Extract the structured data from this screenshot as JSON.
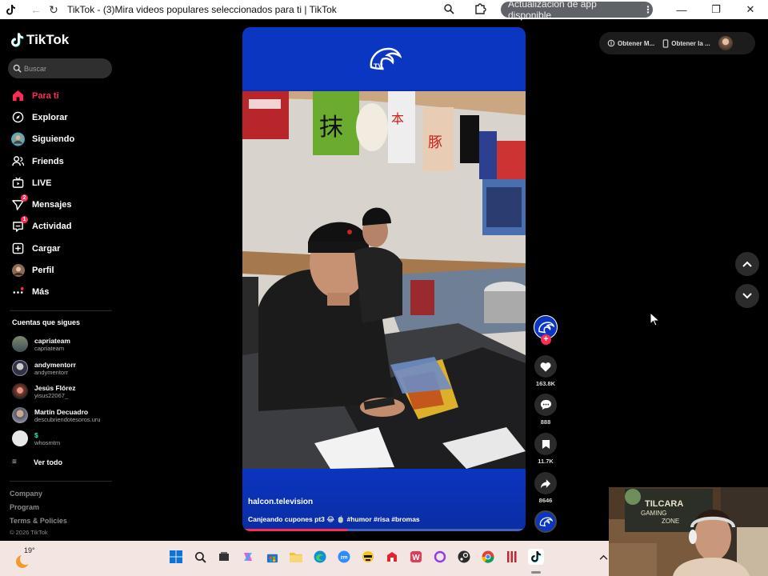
{
  "browser": {
    "tab_title": "TikTok - (3)Mira videos populares seleccionados para ti | TikTok",
    "update_pill": "Actualización de app disponible"
  },
  "sidebar": {
    "logo_text": "TikTok",
    "search_placeholder": "Buscar",
    "menu": [
      {
        "label": "Para ti",
        "icon": "home-icon",
        "active": true
      },
      {
        "label": "Explorar",
        "icon": "compass-icon"
      },
      {
        "label": "Siguiendo",
        "icon": "following-avatar-icon"
      },
      {
        "label": "Friends",
        "icon": "friends-icon"
      },
      {
        "label": "LIVE",
        "icon": "live-tv-icon"
      },
      {
        "label": "Mensajes",
        "icon": "send-icon",
        "badge": "2"
      },
      {
        "label": "Actividad",
        "icon": "activity-icon",
        "badge": "1"
      },
      {
        "label": "Cargar",
        "icon": "upload-plus-icon"
      },
      {
        "label": "Perfil",
        "icon": "profile-avatar-icon"
      },
      {
        "label": "Más",
        "icon": "more-dots-icon"
      }
    ],
    "following_title": "Cuentas que sigues",
    "accounts": [
      {
        "name": "capriateam",
        "handle": "capriateam"
      },
      {
        "name": "andymentorr",
        "handle": "andymentorr"
      },
      {
        "name": "Jesús Flórez",
        "handle": "yisus22067_"
      },
      {
        "name": "Martín Decuadro",
        "handle": "descubriendotesoros.uru"
      },
      {
        "name": "$",
        "handle": "whosmtm"
      }
    ],
    "see_all": "Ver todo",
    "footer": {
      "company": "Company",
      "program": "Program",
      "terms": "Terms & Policies",
      "copyright": "© 2026 TikTok"
    }
  },
  "video": {
    "username": "halcon.television",
    "caption": "Canjeando cupones pt3 😂 🍵 #humor #risa #bromas",
    "progress": 0.37,
    "brand_colors": {
      "banner": "#0a36c2",
      "accent": "#fe2c55"
    }
  },
  "actions": {
    "likes": "163.8K",
    "comments": "888",
    "saves": "11.7K",
    "shares": "8646"
  },
  "topright": {
    "get_app_1": "Obtener M...",
    "get_app_2": "Obtener la ..."
  },
  "taskbar": {
    "temperature": "19°"
  },
  "webcam": {
    "sign_line1": "TILCARA",
    "sign_line2": "GAMING",
    "sign_line3": "ZONE"
  }
}
